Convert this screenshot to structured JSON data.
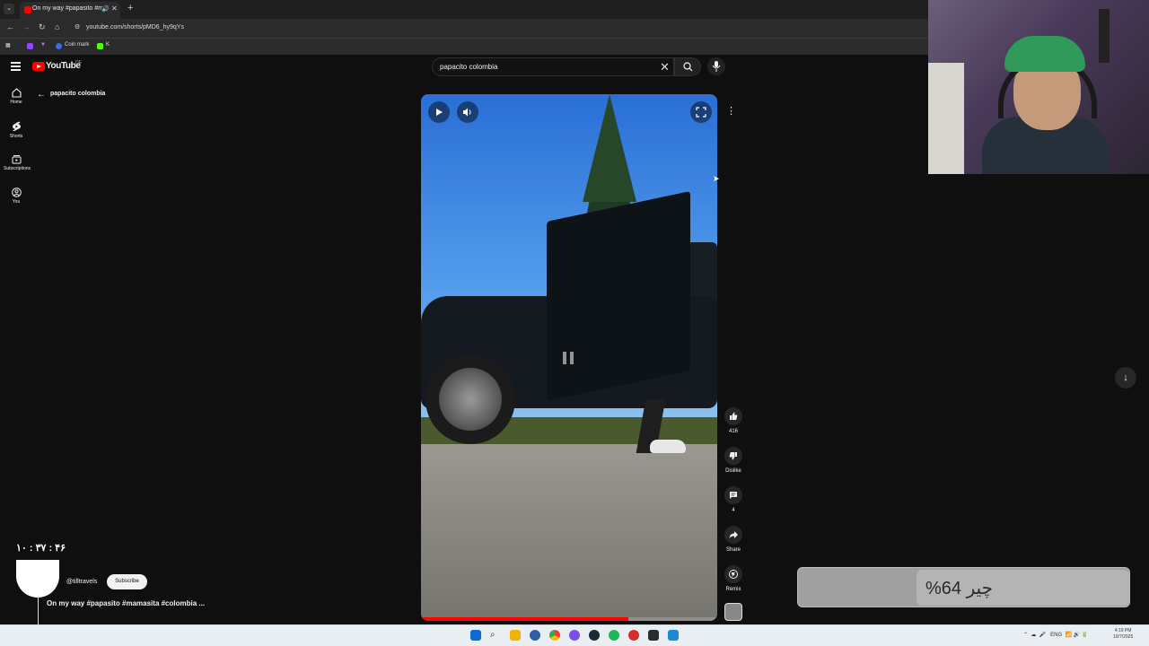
{
  "browser": {
    "tab_title": "On my way #papasito #mamasita #colombia",
    "url": "youtube.com/shorts/pMD6_hy9qYs",
    "bookmarks": [
      "Coin mark",
      "K"
    ]
  },
  "masthead": {
    "logo_text": "YouTube",
    "region": "DE",
    "search_value": "papacito colombia"
  },
  "rail": {
    "items": [
      {
        "label": "Home",
        "icon": "home-icon"
      },
      {
        "label": "Shorts",
        "icon": "shorts-icon"
      },
      {
        "label": "Subscriptions",
        "icon": "subscriptions-icon"
      },
      {
        "label": "You",
        "icon": "you-icon"
      }
    ]
  },
  "page": {
    "query_title": "papacito colombia"
  },
  "video": {
    "progress": 0.7,
    "channel_handle": "@tilltravels",
    "subscribe_label": "Subscribe",
    "title": "On my way #papasito #mamasita #colombia ..."
  },
  "actions": {
    "like_count": "416",
    "dislike_label": "Dislike",
    "comment_count": "4",
    "share_label": "Share",
    "remix_label": "Remix"
  },
  "overlay": {
    "clock_persian": "۱۰ : ۳۷ : ۴۶",
    "battery_text": "چیر 64%"
  },
  "taskbar": {
    "language": "ENG",
    "time": "4:19 PM",
    "date": "10/7/2025"
  },
  "colors": {
    "youtube_red": "#ff0000",
    "background": "#0f0f0f"
  }
}
